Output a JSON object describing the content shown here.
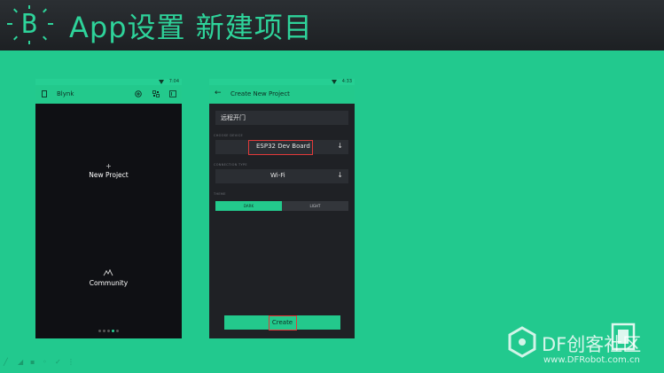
{
  "header": {
    "logo_letter": "B",
    "title": "App设置 新建项目"
  },
  "phone_left": {
    "status_time": "7:04",
    "app_title": "Blynk",
    "icons": [
      "device-icon",
      "add-circle-icon",
      "qr-icon",
      "settings-icon"
    ],
    "new_project_plus": "+",
    "new_project_label": "New Project",
    "community_label": "Community",
    "page_dots": 5,
    "active_dot": 3
  },
  "phone_right": {
    "status_time": "4:33",
    "app_title": "Create New Project",
    "project_name": "远程开门",
    "choose_device_label": "CHOOSE DEVICE",
    "device_value": "ESP32 Dev Board",
    "connection_label": "CONNECTION TYPE",
    "connection_value": "Wi-Fi",
    "theme_label": "THEME",
    "theme_dark": "DARK",
    "theme_light": "LIGHT",
    "create_label": "Create"
  },
  "watermark": {
    "brand": "DF创客社区",
    "url": "www.DFRobot.com.cn"
  },
  "colors": {
    "background": "#22c98e",
    "header": "#2b2f33",
    "accent": "#2ed39a",
    "phone_dark": "#0f1014",
    "highlight": "#e23a3a"
  }
}
